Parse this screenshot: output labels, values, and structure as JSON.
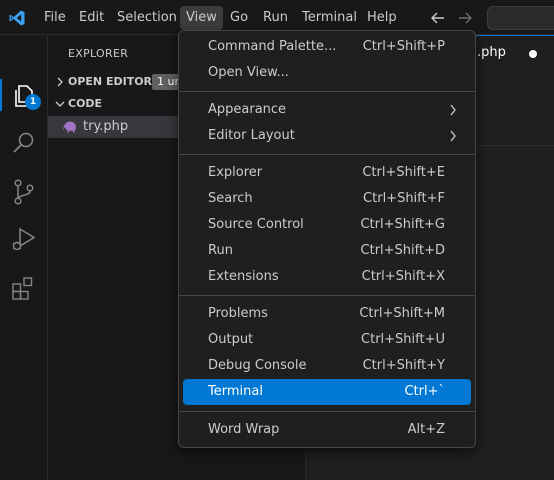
{
  "colors": {
    "accent": "#0078d4",
    "menu_bg": "#1f1f1f",
    "selected_bg": "#0078d4",
    "php_icon": "#a074c4"
  },
  "titlebar": {
    "logo_icon": "vscode-logo-icon",
    "menus": [
      "File",
      "Edit",
      "Selection",
      "View",
      "Go",
      "Run",
      "Terminal",
      "Help"
    ],
    "active_menu": "View",
    "back_icon": "arrow-left-icon",
    "forward_icon": "arrow-right-icon"
  },
  "activitybar": {
    "items": [
      "explorer-icon",
      "search-icon",
      "source-control-icon",
      "run-debug-icon",
      "extensions-icon"
    ],
    "explorer_badge": "1"
  },
  "sidebar": {
    "title": "EXPLORER",
    "open_editors": {
      "label": "OPEN EDITORS",
      "badge": "1 un"
    },
    "folder": {
      "label": "CODE"
    },
    "files": [
      {
        "name": "try.php",
        "icon": "php-elephant-icon"
      }
    ]
  },
  "editor": {
    "tab_label": ".php"
  },
  "view_menu": {
    "groups": [
      [
        {
          "label": "Command Palette...",
          "shortcut": "Ctrl+Shift+P"
        },
        {
          "label": "Open View...",
          "shortcut": ""
        }
      ],
      [
        {
          "label": "Appearance",
          "submenu": true
        },
        {
          "label": "Editor Layout",
          "submenu": true
        }
      ],
      [
        {
          "label": "Explorer",
          "shortcut": "Ctrl+Shift+E"
        },
        {
          "label": "Search",
          "shortcut": "Ctrl+Shift+F"
        },
        {
          "label": "Source Control",
          "shortcut": "Ctrl+Shift+G"
        },
        {
          "label": "Run",
          "shortcut": "Ctrl+Shift+D"
        },
        {
          "label": "Extensions",
          "shortcut": "Ctrl+Shift+X"
        }
      ],
      [
        {
          "label": "Problems",
          "shortcut": "Ctrl+Shift+M"
        },
        {
          "label": "Output",
          "shortcut": "Ctrl+Shift+U"
        },
        {
          "label": "Debug Console",
          "shortcut": "Ctrl+Shift+Y"
        },
        {
          "label": "Terminal",
          "shortcut": "Ctrl+`",
          "selected": true
        }
      ],
      [
        {
          "label": "Word Wrap",
          "shortcut": "Alt+Z"
        }
      ]
    ]
  }
}
